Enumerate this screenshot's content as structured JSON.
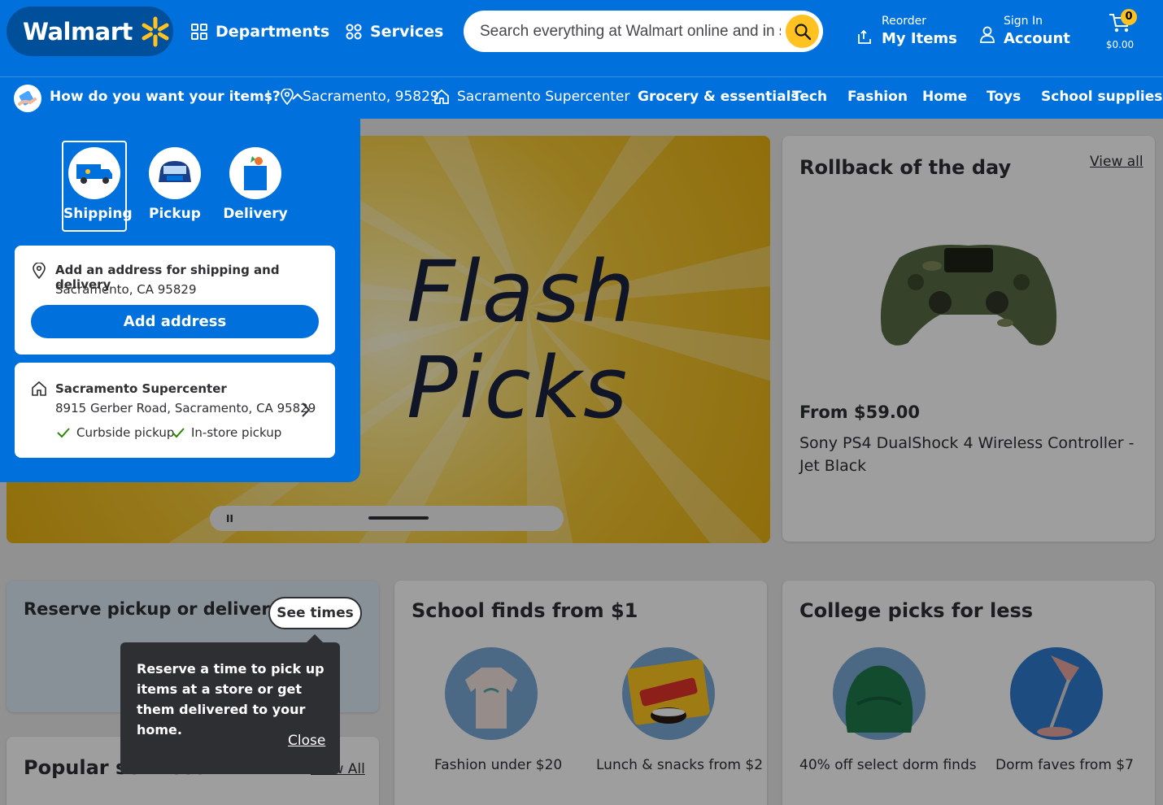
{
  "header": {
    "logo_text": "Walmart",
    "departments": "Departments",
    "services": "Services",
    "search_placeholder": "Search everything at Walmart online and in store",
    "reorder_small": "Reorder",
    "reorder_big": "My Items",
    "signin_small": "Sign In",
    "signin_big": "Account",
    "cart_count": "0",
    "cart_total": "$0.00"
  },
  "subnav": {
    "intent_prompt": "How do you want your items?",
    "separator": "|",
    "location": "Sacramento, 95829",
    "store": "Sacramento Supercenter",
    "links": [
      "Grocery & essentials",
      "Tech",
      "Fashion",
      "Home",
      "Toys",
      "School supplies"
    ]
  },
  "intent_panel": {
    "options": [
      "Shipping",
      "Pickup",
      "Delivery"
    ],
    "selected": "Shipping",
    "address_card": {
      "title": "Add an address for shipping and delivery",
      "subtitle": "Sacramento, CA 95829",
      "button": "Add address"
    },
    "store_card": {
      "title": "Sacramento Supercenter",
      "address": "8915 Gerber Road, Sacramento, CA 95829",
      "features": [
        "Curbside pickup",
        "In-store pickup"
      ]
    }
  },
  "hero": {
    "line1": "Flash",
    "line2": "Picks",
    "pause_glyph": "II"
  },
  "rollback": {
    "title": "Rollback of the day",
    "view_all": "View all",
    "price": "From $59.00",
    "product": "Sony PS4 DualShock 4 Wireless Controller - Jet Black"
  },
  "reserve": {
    "title": "Reserve pickup or delivery",
    "button": "See times",
    "tooltip_text": "Reserve a time to pick up items at a store or get them delivered to your home.",
    "tooltip_close": "Close"
  },
  "popular": {
    "title": "Popular services",
    "view_all": "View All"
  },
  "school": {
    "title": "School finds from $1",
    "items": [
      "Fashion under $20",
      "Lunch & snacks from $2"
    ]
  },
  "college": {
    "title": "College picks for less",
    "items": [
      "40% off select dorm finds",
      "Dorm faves from $7"
    ]
  },
  "colors": {
    "brand_blue": "#0071dc",
    "spark_yellow": "#ffc220",
    "dark_text": "#2e2f32"
  }
}
